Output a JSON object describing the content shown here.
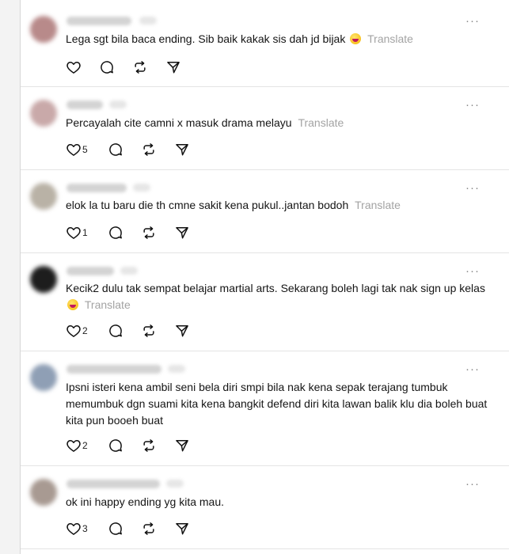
{
  "ui": {
    "translate_label": "Translate",
    "more_glyph": "···",
    "icons": [
      "heart-icon",
      "comment-icon",
      "repost-icon",
      "share-icon",
      "more-icon"
    ]
  },
  "posts": [
    {
      "text": "Lega sgt bila baca ending. Sib baik kakak sis dah jd bijak",
      "emoji": true,
      "likes": "",
      "avatar_color": "#b88a8a"
    },
    {
      "text": "Percayalah cite camni x masuk drama melayu",
      "emoji": false,
      "likes": "5",
      "avatar_color": "#c9a9a9"
    },
    {
      "text": "elok la tu baru die th cmne sakit kena pukul..jantan bodoh",
      "emoji": false,
      "likes": "1",
      "avatar_color": "#b9b2a6"
    },
    {
      "text": "Kecik2 dulu tak sempat belajar martial arts. Sekarang boleh lagi tak nak sign up kelas",
      "emoji": true,
      "likes": "2",
      "avatar_color": "#1d1d1d"
    },
    {
      "text": "Ipsni isteri kena ambil seni bela diri smpi bila nak kena sepak terajang tumbuk memumbuk dgn suami kita kena bangkit defend diri kita lawan balik klu dia boleh buat kita pun booeh buat",
      "emoji": false,
      "likes": "2",
      "avatar_color": "#8f9fb5"
    },
    {
      "text": "ok ini happy ending yg kita mau.",
      "emoji": false,
      "likes": "3",
      "avatar_color": "#a89a92"
    }
  ]
}
